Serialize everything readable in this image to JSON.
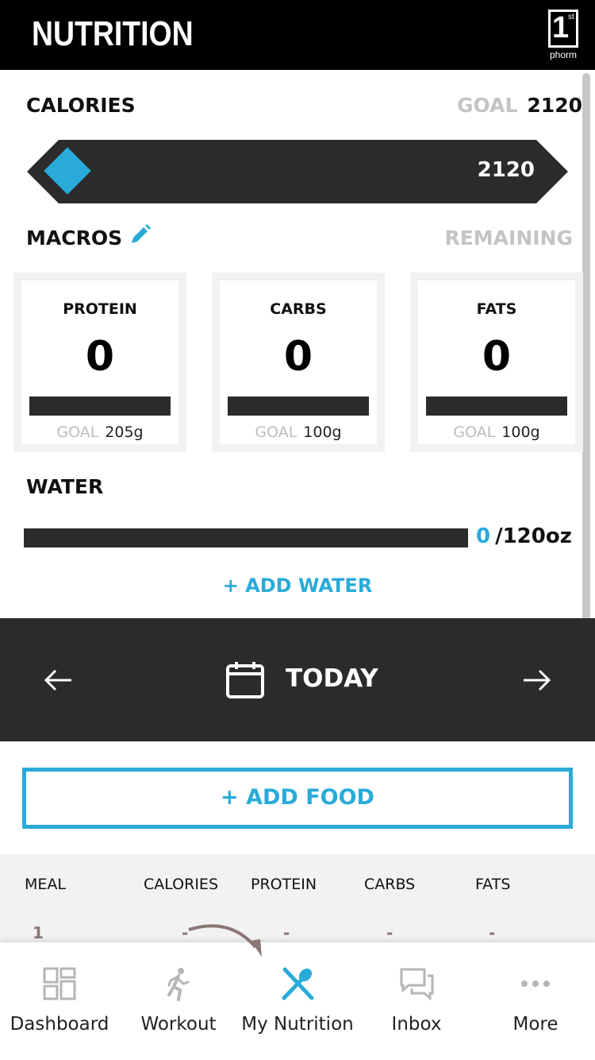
{
  "header": {
    "title": "NUTRITION",
    "logo_number": "1",
    "logo_super": "st",
    "logo_text": "phorm"
  },
  "calories": {
    "label": "CALORIES",
    "goal_word": "GOAL",
    "goal_value": "2120",
    "bar_value": "2120",
    "accent": "#29abd9"
  },
  "macros": {
    "label": "MACROS",
    "remaining_label": "REMAINING",
    "cards": [
      {
        "name": "PROTEIN",
        "value": "0",
        "goal_word": "GOAL",
        "goal": "205g"
      },
      {
        "name": "CARBS",
        "value": "0",
        "goal_word": "GOAL",
        "goal": "100g"
      },
      {
        "name": "FATS",
        "value": "0",
        "goal_word": "GOAL",
        "goal": "100g"
      }
    ]
  },
  "water": {
    "label": "WATER",
    "current": "0",
    "total": "/120oz",
    "add_label": "+ ADD WATER"
  },
  "date_nav": {
    "label": "TODAY",
    "prev_icon": "arrow-left-icon",
    "next_icon": "arrow-right-icon"
  },
  "add_food_label": "+ ADD FOOD",
  "meal_table": {
    "headers": [
      "MEAL",
      "CALORIES",
      "PROTEIN",
      "CARBS",
      "FATS"
    ],
    "rows": [
      [
        "1",
        "-",
        "-",
        "-",
        "-"
      ]
    ]
  },
  "tabbar": {
    "items": [
      {
        "label": "Dashboard",
        "icon": "dashboard-icon",
        "active": false
      },
      {
        "label": "Workout",
        "icon": "runner-icon",
        "active": false
      },
      {
        "label": "My Nutrition",
        "icon": "spoon-knife-icon",
        "active": true
      },
      {
        "label": "Inbox",
        "icon": "chat-bubbles-icon",
        "active": false
      },
      {
        "label": "More",
        "icon": "more-dots-icon",
        "active": false
      }
    ]
  },
  "colors": {
    "accent": "#29abd9",
    "dark": "#2b2b2b",
    "muted": "#c4c4c4"
  }
}
